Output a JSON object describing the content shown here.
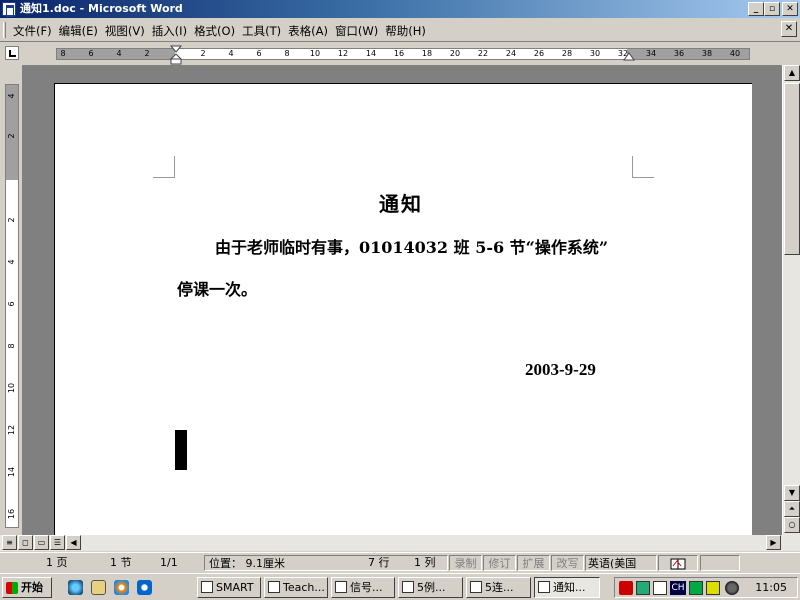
{
  "window": {
    "title": "通知1.doc - Microsoft Word",
    "minimize": "_",
    "restore": "▫",
    "close": "✕"
  },
  "menu": [
    "文件(F)",
    "编辑(E)",
    "视图(V)",
    "插入(I)",
    "格式(O)",
    "工具(T)",
    "表格(A)",
    "窗口(W)",
    "帮助(H)"
  ],
  "doc_close": "✕",
  "ruler": {
    "left_numbers": [
      "8",
      "6",
      "4",
      "2"
    ],
    "right_numbers": [
      "2",
      "4",
      "6",
      "8",
      "10",
      "12",
      "14",
      "16",
      "18",
      "20",
      "22",
      "24",
      "26",
      "28",
      "30",
      "32",
      "34",
      "36",
      "38",
      "40"
    ],
    "vertical_numbers": [
      "4",
      "2",
      "2",
      "4",
      "6",
      "8",
      "10",
      "12",
      "14",
      "16"
    ]
  },
  "document": {
    "title": "通知",
    "line1": "由于老师临时有事，01014032 班 5-6 节“操作系统”",
    "line2": "停课一次。",
    "date": "2003-9-29"
  },
  "status": {
    "page": "1 页",
    "section": "1 节",
    "page_of": "1/1",
    "position": "位置： 9.1厘米",
    "line": "7 行",
    "column": "1 列",
    "rec": "录制",
    "trk": "修订",
    "ext": "扩展",
    "ovr": "改写",
    "language": "英语(美国"
  },
  "taskbar": {
    "start": "开始",
    "tasks": [
      "SMART",
      "Teach...",
      "信号...",
      "5例...",
      "5连...",
      "通知..."
    ],
    "active_task": "通知...",
    "tray_lang": "CH",
    "clock": "11:05"
  },
  "colors": {
    "title_gradient_start": "#0a246a",
    "title_gradient_end": "#a6caf0",
    "face": "#d4d0c8",
    "workspace": "#808080"
  }
}
